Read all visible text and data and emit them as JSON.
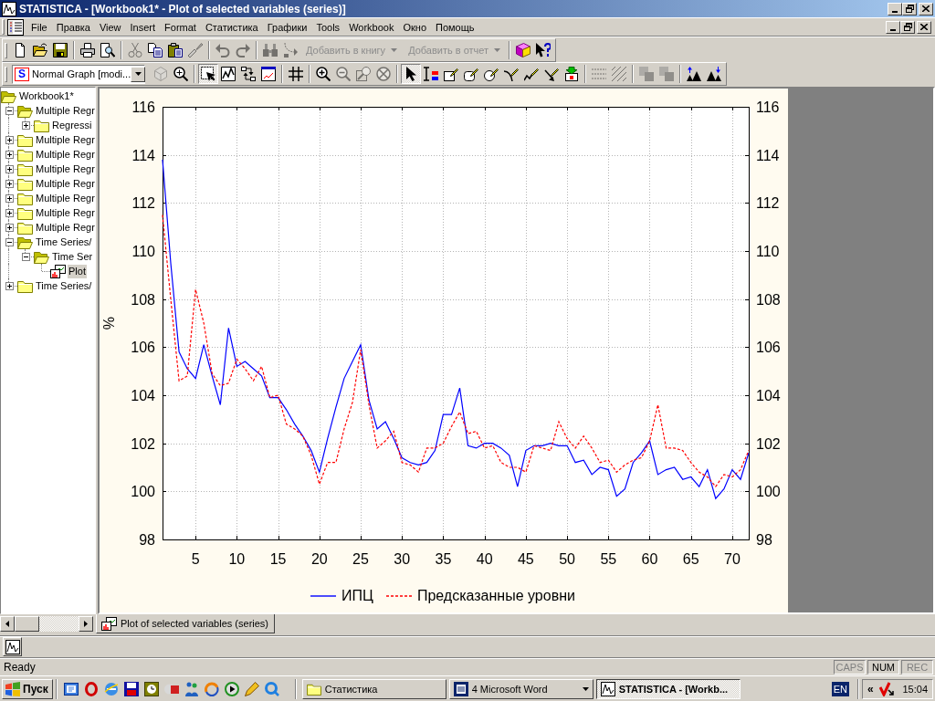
{
  "window": {
    "title": "STATISTICA - [Workbook1* - Plot of selected variables (series)]"
  },
  "menu_bar": {
    "items": [
      "File",
      "Правка",
      "View",
      "Insert",
      "Format",
      "Статистика",
      "Графики",
      "Tools",
      "Workbook",
      "Окно",
      "Помощь"
    ]
  },
  "toolbars": [
    {
      "groups": [
        [
          {
            "kind": "icon",
            "disabled": false
          },
          {
            "kind": "icon",
            "disabled": false
          },
          {
            "kind": "icon",
            "disabled": false
          }
        ],
        [
          {
            "kind": "icon",
            "disabled": false
          },
          {
            "kind": "icon",
            "disabled": false
          }
        ],
        [
          {
            "kind": "icon",
            "disabled": true
          },
          {
            "kind": "icon",
            "disabled": false
          },
          {
            "kind": "icon",
            "disabled": false
          },
          {
            "kind": "icon",
            "disabled": true
          }
        ],
        [
          {
            "kind": "icon",
            "disabled": true
          },
          {
            "kind": "icon",
            "disabled": true
          }
        ],
        [
          {
            "kind": "icon",
            "disabled": true
          },
          {
            "kind": "icon",
            "disabled": true
          },
          {
            "kind": "dropdown",
            "label": "Добавить в книгу",
            "disabled": true
          },
          {
            "kind": "dropdown",
            "label": "Добавить в отчет",
            "disabled": true
          }
        ],
        [
          {
            "kind": "icon",
            "disabled": false
          },
          {
            "kind": "icon",
            "disabled": false
          }
        ]
      ]
    },
    {
      "groups": [
        [
          {
            "kind": "combo",
            "icon_letter": "S",
            "value": "Normal Graph [modi...",
            "disabled": false
          },
          {
            "kind": "icon",
            "disabled": true,
            "pressed": false
          },
          {
            "kind": "icon",
            "disabled": false,
            "pressed": false
          }
        ],
        [
          {
            "kind": "icon",
            "disabled": false,
            "pressed": true
          },
          {
            "kind": "icon",
            "disabled": false,
            "pressed": false
          },
          {
            "kind": "icon",
            "disabled": false,
            "pressed": false
          },
          {
            "kind": "icon",
            "disabled": false,
            "pressed": false
          }
        ],
        [
          {
            "kind": "icon",
            "disabled": false,
            "pressed": false
          }
        ],
        [
          {
            "kind": "icon",
            "disabled": false,
            "pressed": false
          },
          {
            "kind": "icon",
            "disabled": true,
            "pressed": false
          },
          {
            "kind": "icon",
            "disabled": true,
            "pressed": false
          },
          {
            "kind": "icon",
            "disabled": true,
            "pressed": false
          }
        ],
        [
          {
            "kind": "icon",
            "disabled": false,
            "pressed": true
          },
          {
            "kind": "icon",
            "disabled": false,
            "pressed": false
          },
          {
            "kind": "icon",
            "disabled": false,
            "pressed": false
          },
          {
            "kind": "icon",
            "disabled": false,
            "pressed": false
          },
          {
            "kind": "icon",
            "disabled": false,
            "pressed": false
          },
          {
            "kind": "icon",
            "disabled": false,
            "pressed": false
          },
          {
            "kind": "icon",
            "disabled": false,
            "pressed": false
          },
          {
            "kind": "icon",
            "disabled": false,
            "pressed": false
          },
          {
            "kind": "icon",
            "disabled": false,
            "pressed": false
          }
        ],
        [
          {
            "kind": "icon",
            "disabled": true,
            "pressed": false
          },
          {
            "kind": "icon",
            "disabled": true,
            "pressed": false
          }
        ],
        [
          {
            "kind": "icon",
            "disabled": true,
            "pressed": false
          },
          {
            "kind": "icon",
            "disabled": true,
            "pressed": false
          }
        ],
        [
          {
            "kind": "icon",
            "disabled": false,
            "pressed": false
          },
          {
            "kind": "icon",
            "disabled": false,
            "pressed": false
          }
        ]
      ]
    }
  ],
  "tree": {
    "items": [
      {
        "kind": "workbook",
        "label": "Workbook1*",
        "expanded": true,
        "selected": false,
        "children": [
          {
            "kind": "folder",
            "label": "Multiple Regr",
            "expanded": true,
            "selected": false,
            "children": [
              {
                "kind": "folder",
                "label": "Regressi",
                "expanded": false,
                "selected": false
              }
            ]
          },
          {
            "kind": "folder",
            "label": "Multiple Regr",
            "expanded": false,
            "selected": false
          },
          {
            "kind": "folder",
            "label": "Multiple Regr",
            "expanded": false,
            "selected": false
          },
          {
            "kind": "folder",
            "label": "Multiple Regr",
            "expanded": false,
            "selected": false
          },
          {
            "kind": "folder",
            "label": "Multiple Regr",
            "expanded": false,
            "selected": false
          },
          {
            "kind": "folder",
            "label": "Multiple Regr",
            "expanded": false,
            "selected": false
          },
          {
            "kind": "folder",
            "label": "Multiple Regr",
            "expanded": false,
            "selected": false
          },
          {
            "kind": "folder",
            "label": "Multiple Regr",
            "expanded": false,
            "selected": false
          },
          {
            "kind": "folder",
            "label": "Time Series/",
            "expanded": true,
            "selected": false,
            "children": [
              {
                "kind": "folder",
                "label": "Time Ser",
                "expanded": true,
                "selected": false,
                "children": [
                  {
                    "kind": "graph",
                    "label": "Plot",
                    "selected": true
                  }
                ]
              }
            ]
          },
          {
            "kind": "folder",
            "label": "Time Series/",
            "expanded": false,
            "selected": false
          }
        ]
      }
    ]
  },
  "graph": {
    "chart_data": {
      "type": "line",
      "ylabel": "%",
      "x": [
        1,
        2,
        3,
        4,
        5,
        6,
        7,
        8,
        9,
        10,
        11,
        12,
        13,
        14,
        15,
        16,
        17,
        18,
        19,
        20,
        21,
        22,
        23,
        24,
        25,
        26,
        27,
        28,
        29,
        30,
        31,
        32,
        33,
        34,
        35,
        36,
        37,
        38,
        39,
        40,
        41,
        42,
        43,
        44,
        45,
        46,
        47,
        48,
        49,
        50,
        51,
        52,
        53,
        54,
        55,
        56,
        57,
        58,
        59,
        60,
        61,
        62,
        63,
        64,
        65,
        66,
        67,
        68,
        69,
        70,
        71,
        72
      ],
      "series": [
        {
          "name": "ИПЦ",
          "color": "#0000ff",
          "line_style": "solid",
          "values": [
            113.8,
            109.5,
            105.8,
            105.1,
            104.7,
            106.1,
            104.8,
            103.6,
            106.8,
            105.2,
            105.4,
            105.1,
            104.8,
            103.9,
            103.9,
            103.4,
            102.8,
            102.3,
            101.7,
            100.8,
            102.2,
            103.5,
            104.7,
            105.4,
            106.1,
            103.8,
            102.6,
            102.9,
            102.2,
            101.4,
            101.2,
            101.1,
            101.2,
            101.7,
            103.2,
            103.2,
            104.3,
            101.9,
            101.8,
            102.0,
            102.0,
            101.8,
            101.5,
            100.2,
            101.7,
            101.9,
            101.9,
            102.0,
            101.9,
            101.9,
            101.2,
            101.3,
            100.7,
            101.0,
            100.9,
            99.8,
            100.1,
            101.2,
            101.6,
            102.1,
            100.7,
            100.9,
            101.0,
            100.5,
            100.6,
            100.2,
            100.9,
            99.7,
            100.1,
            100.9,
            100.5,
            101.6
          ]
        },
        {
          "name": "Предсказанные уровни",
          "color": "#ff0000",
          "line_style": "dashed",
          "values": [
            111.5,
            108.0,
            104.6,
            104.8,
            108.4,
            107.0,
            104.9,
            104.4,
            104.5,
            105.5,
            105.1,
            104.6,
            105.2,
            103.9,
            104.0,
            102.8,
            102.6,
            102.3,
            101.5,
            100.3,
            101.2,
            101.2,
            102.6,
            103.7,
            105.9,
            103.6,
            101.8,
            102.1,
            102.5,
            101.2,
            101.1,
            100.8,
            101.8,
            101.8,
            102.0,
            102.7,
            103.3,
            102.4,
            102.5,
            101.8,
            101.9,
            101.2,
            101.0,
            101.0,
            100.8,
            101.9,
            101.8,
            101.7,
            102.9,
            102.2,
            101.8,
            102.3,
            101.8,
            101.2,
            101.3,
            100.8,
            101.1,
            101.3,
            101.4,
            102.1,
            103.6,
            101.8,
            101.8,
            101.7,
            101.2,
            100.8,
            100.6,
            100.2,
            100.7,
            100.6,
            100.9,
            101.7
          ]
        }
      ],
      "xlim": [
        1,
        72
      ],
      "ylim": [
        98,
        116
      ],
      "y2lim": [
        98,
        116
      ],
      "xticks": [
        5,
        10,
        15,
        20,
        25,
        30,
        35,
        40,
        45,
        50,
        55,
        60,
        65,
        70
      ],
      "yticks": [
        98,
        100,
        102,
        104,
        106,
        108,
        110,
        112,
        114,
        116
      ],
      "y2ticks": [
        98,
        100,
        102,
        104,
        106,
        108,
        110,
        112,
        114,
        116
      ],
      "grid": true,
      "legend": "bottom"
    }
  },
  "document_tabs": [
    {
      "label": "Plot of selected variables (series)",
      "selected": true
    }
  ],
  "status_bar": {
    "text": "Ready",
    "indicators": [
      {
        "label": "CAPS",
        "on": false
      },
      {
        "label": "NUM",
        "on": true
      },
      {
        "label": "REC",
        "on": false
      }
    ]
  },
  "taskbar": {
    "start": "Пуск",
    "tasks": [
      {
        "kind": "folder",
        "label": "Статистика",
        "selected": false
      },
      {
        "kind": "group",
        "label": "4 Microsoft Word",
        "selected": false
      },
      {
        "kind": "app",
        "label": "STATISTICA - [Workb...",
        "selected": true
      }
    ],
    "language": "EN",
    "tray_toggle": "«",
    "clock": "15:04"
  }
}
